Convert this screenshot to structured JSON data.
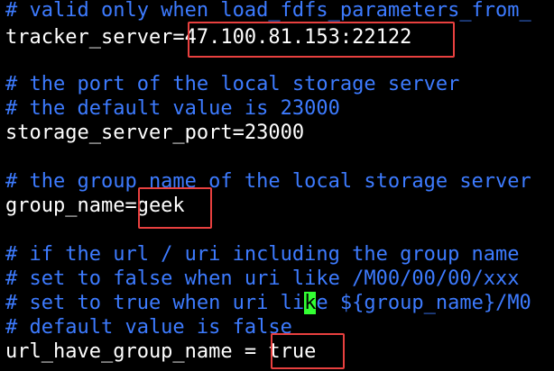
{
  "colors": {
    "background": "#000000",
    "comment": "#3d7bff",
    "text": "#ffffff",
    "cursor": "#33ff33",
    "highlight_box": "#e8403f"
  },
  "lines": {
    "c_valid_only": "# valid only when load_fdfs_parameters_from_",
    "tracker_server": "tracker_server=47.100.81.153:22122",
    "c_port_of": "# the port of the local storage server",
    "c_default_23000": "# the default value is 23000",
    "storage_server_port": "storage_server_port=23000",
    "c_group_name_of": "# the group name of the local storage server",
    "group_name": "group_name=geek",
    "c_if_url": "# if the url / uri including the group name",
    "c_set_false": "# set to false when uri like /M00/00/00/xxx",
    "c_set_true_before_cursor": "# set to true when uri li",
    "c_set_true_cursor_char": "k",
    "c_set_true_after_cursor": "e ${group_name}/M0",
    "c_default_false": "# default value is false",
    "url_have_group_name": "url_have_group_name = true"
  }
}
